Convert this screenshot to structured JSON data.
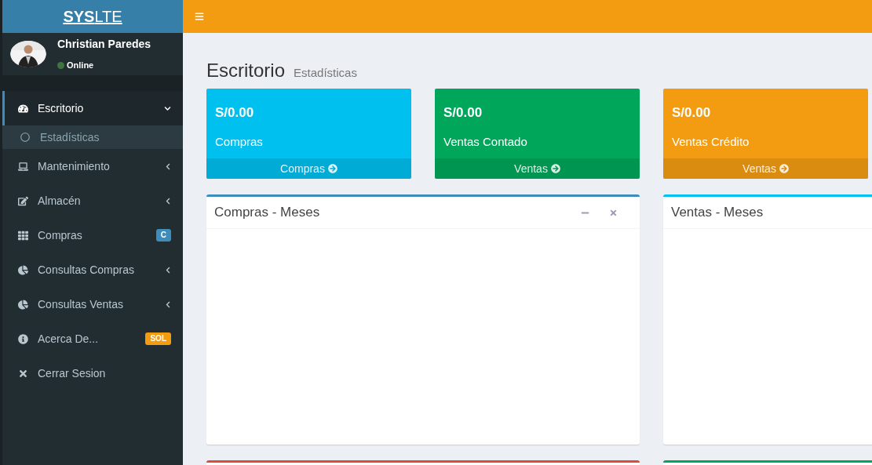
{
  "logo": {
    "bold": "SYS",
    "light": "LTE"
  },
  "user": {
    "name": "Christian Paredes",
    "status": "Online",
    "online": true
  },
  "sidebar": {
    "items": [
      {
        "label": "Escritorio",
        "kind": "tree",
        "expanded": true,
        "selected": true,
        "children": [
          {
            "label": "Estadísticas",
            "selected": true
          }
        ]
      },
      {
        "label": "Mantenimiento",
        "kind": "tree",
        "expanded": false,
        "selected": false
      },
      {
        "label": "Almacén",
        "kind": "tree",
        "expanded": false,
        "selected": false
      },
      {
        "label": "Compras",
        "kind": "badge",
        "badge": "C",
        "color": "#3c8dbc",
        "selected": false
      },
      {
        "label": "Consultas Compras",
        "kind": "tree",
        "expanded": false,
        "selected": false
      },
      {
        "label": "Consultas Ventas",
        "kind": "tree",
        "expanded": false,
        "selected": false
      },
      {
        "label": "Acerca De...",
        "kind": "badge",
        "badge": "SOL",
        "color": "#f39c12",
        "selected": false
      },
      {
        "label": "Cerrar Sesion",
        "kind": "plain",
        "selected": false
      }
    ]
  },
  "header": {
    "title": "Escritorio",
    "subtitle": "Estadísticas"
  },
  "info_boxes": [
    {
      "value": "S/0.00",
      "label": "Compras",
      "link": "Compras",
      "color": "#00c0ef"
    },
    {
      "value": "S/0.00",
      "label": "Ventas Contado",
      "link": "Ventas",
      "color": "#00a65a"
    },
    {
      "value": "S/0.00",
      "label": "Ventas Crédito",
      "link": "Ventas",
      "color": "#f39c12"
    }
  ],
  "boxes": [
    {
      "title": "Compras - Meses",
      "color": "#3c8dbc",
      "tools": true
    },
    {
      "title": "Ventas - Meses",
      "color": "#00c0ef"
    }
  ],
  "lower_boxes": [
    {
      "color": "#dd4b39"
    },
    {
      "color": "#00a65a"
    }
  ]
}
